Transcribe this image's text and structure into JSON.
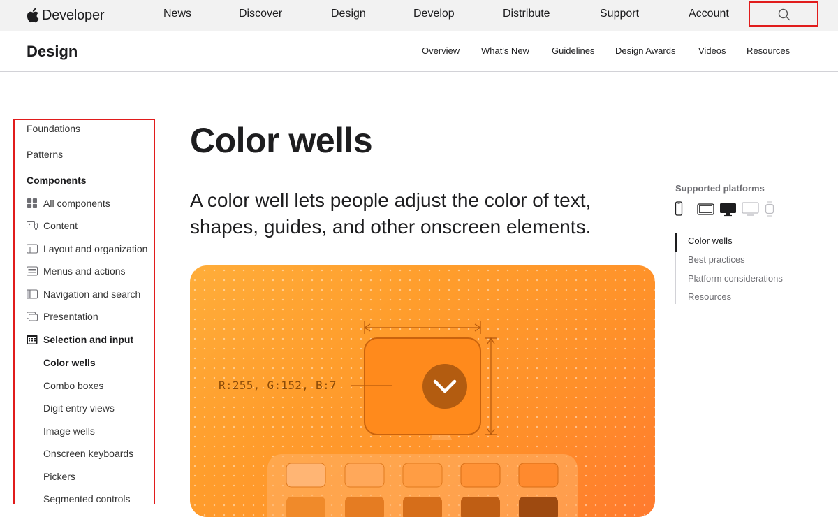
{
  "globalnav": {
    "brand": "Developer",
    "items": [
      "News",
      "Discover",
      "Design",
      "Develop",
      "Distribute",
      "Support",
      "Account"
    ],
    "search_icon": "search-icon"
  },
  "localnav": {
    "title": "Design",
    "links": [
      "Overview",
      "What's New",
      "Guidelines",
      "Design Awards",
      "Videos",
      "Resources"
    ]
  },
  "sidebar": {
    "top_items": [
      "Foundations",
      "Patterns"
    ],
    "section_heading": "Components",
    "categories": [
      {
        "label": "All components",
        "icon": "grid-icon"
      },
      {
        "label": "Content",
        "icon": "content-icon"
      },
      {
        "label": "Layout and organization",
        "icon": "layout-icon"
      },
      {
        "label": "Menus and actions",
        "icon": "menu-icon"
      },
      {
        "label": "Navigation and search",
        "icon": "sidebar-icon"
      },
      {
        "label": "Presentation",
        "icon": "windows-icon"
      },
      {
        "label": "Selection and input",
        "icon": "calendar-icon"
      }
    ],
    "children": [
      "Color wells",
      "Combo boxes",
      "Digit entry views",
      "Image wells",
      "Onscreen keyboards",
      "Pickers",
      "Segmented controls"
    ]
  },
  "main": {
    "title": "Color wells",
    "lede": "A color well lets people adjust the color of text, shapes, guides, and other onscreen elements.",
    "hero": {
      "rgb_label": "R:255, G:152, B:7"
    }
  },
  "rail": {
    "platforms_title": "Supported platforms",
    "platform_icons": [
      "iphone-icon",
      "ipad-icon",
      "mac-icon",
      "tv-icon",
      "watch-icon"
    ],
    "toc": [
      "Color wells",
      "Best practices",
      "Platform considerations",
      "Resources"
    ]
  },
  "colors": {
    "accent_red_outline": "#e11c1c",
    "hero_orange": "#ff9d2c",
    "well_orange": "#ff8a1c"
  }
}
